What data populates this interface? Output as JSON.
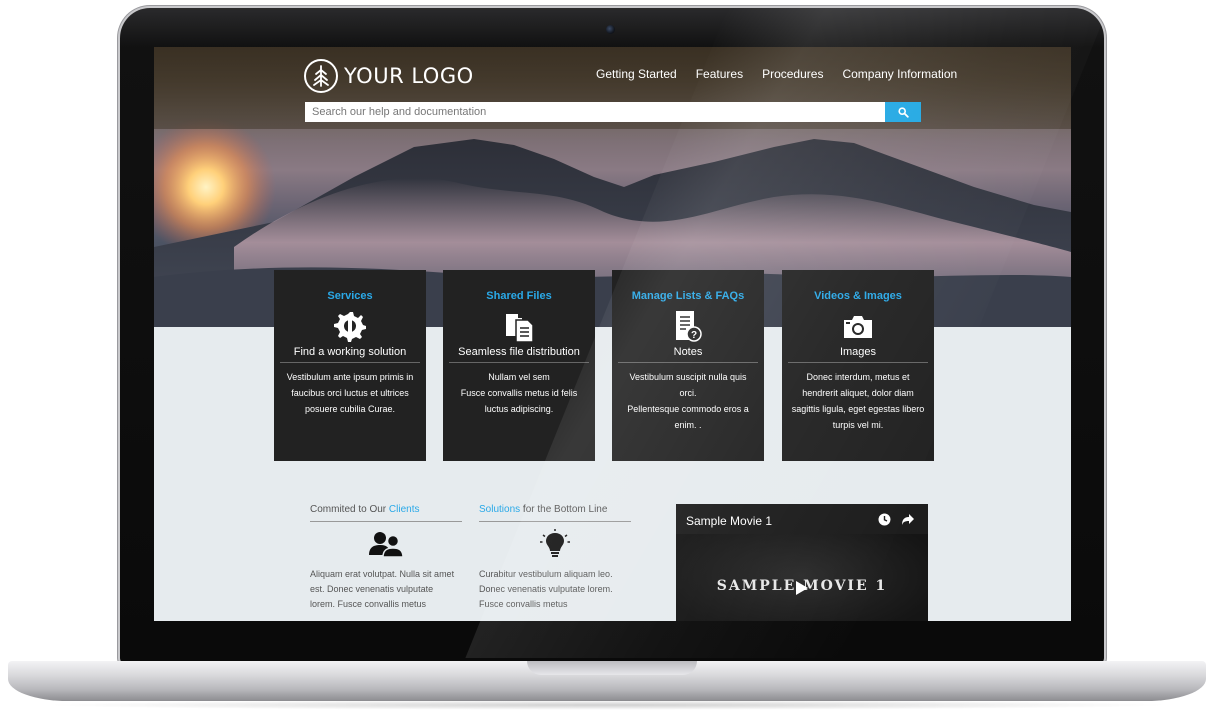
{
  "header": {
    "logo_text": "YOUR LOGO",
    "nav": [
      "Getting Started",
      "Features",
      "Procedures",
      "Company Information"
    ],
    "search_placeholder": "Search our help and documentation"
  },
  "cards": [
    {
      "title": "Services",
      "icon": "wrench-gear-icon",
      "subtitle": "Find a working solution",
      "body": [
        "Vestibulum ante ipsum primis in",
        "faucibus orci luctus et ultrices",
        "posuere cubilia Curae."
      ]
    },
    {
      "title": "Shared Files",
      "icon": "files-icon",
      "subtitle": "Seamless file distribution",
      "body": [
        "Nullam vel sem",
        "Fusce convallis metus id felis",
        "luctus adipiscing."
      ]
    },
    {
      "title": "Manage Lists & FAQs",
      "icon": "list-question-icon",
      "subtitle": "Notes",
      "body": [
        "Vestibulum suscipit nulla quis",
        "orci.",
        "Pellentesque commodo eros a",
        "enim. ."
      ]
    },
    {
      "title": "Videos & Images",
      "icon": "camera-icon",
      "subtitle": "Images",
      "body": [
        "Donec interdum, metus et",
        "hendrerit aliquet, dolor diam",
        "sagittis ligula, eget egestas libero",
        "turpis vel mi."
      ]
    }
  ],
  "columns": [
    {
      "title_prefix": "Commited to Our ",
      "title_highlight": "Clients",
      "title_suffix": "",
      "icon": "users-icon",
      "body": [
        "Aliquam erat volutpat. Nulla sit amet",
        "est. Donec venenatis vulputate",
        "lorem. Fusce convallis metus"
      ]
    },
    {
      "title_prefix": "",
      "title_highlight": "Solutions",
      "title_suffix": " for the Bottom Line",
      "icon": "lightbulb-icon",
      "body": [
        "Curabitur vestibulum aliquam leo.",
        "Donec venenatis vulputate lorem.",
        "Fusce convallis metus"
      ]
    }
  ],
  "video": {
    "title": "Sample Movie 1",
    "frame_text": "SAMPLE MOVIE 1",
    "icons": [
      "clock-icon",
      "share-icon",
      "play-icon"
    ]
  },
  "colors": {
    "accent": "#1fa7e3",
    "card_bg": "#222222",
    "page_bg": "#e6ebee"
  }
}
